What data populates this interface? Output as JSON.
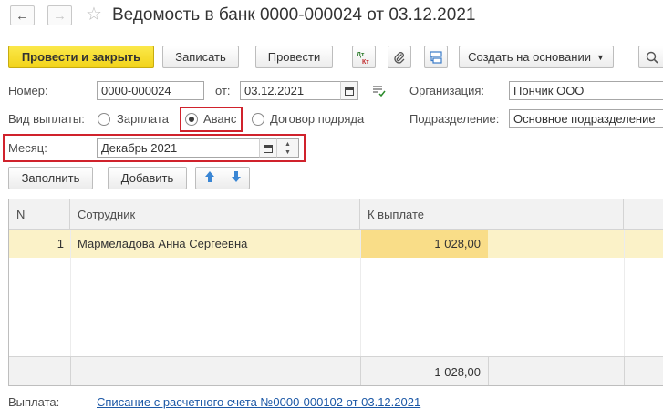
{
  "header": {
    "back_icon": "arrow-left-icon",
    "forward_icon": "arrow-right-icon",
    "favorite_icon": "star-icon",
    "title": "Ведомость в банк 0000-000024 от 03.12.2021"
  },
  "toolbar": {
    "post_close_label": "Провести и закрыть",
    "save_label": "Записать",
    "post_label": "Провести",
    "dtkt_top": "Дт",
    "dtkt_bottom": "Кт",
    "create_based_label": "Создать на основании"
  },
  "form": {
    "number_label": "Номер:",
    "number_value": "0000-000024",
    "date_label": "от:",
    "date_value": "03.12.2021",
    "org_label": "Организация:",
    "org_value": "Пончик ООО",
    "payment_type_label": "Вид выплаты:",
    "payment_options": [
      "Зарплата",
      "Аванс",
      "Договор подряда"
    ],
    "selected_payment": "Аванс",
    "division_label": "Подразделение:",
    "division_value": "Основное подразделение",
    "month_label": "Месяц:",
    "month_value": "Декабрь 2021"
  },
  "table_toolbar": {
    "fill_label": "Заполнить",
    "add_label": "Добавить"
  },
  "table": {
    "columns": [
      "N",
      "Сотрудник",
      "К выплате"
    ],
    "rows": [
      {
        "n": "1",
        "employee": "Мармеладова Анна Сергеевна",
        "amount": "1 028,00"
      }
    ],
    "total": "1 028,00"
  },
  "payment": {
    "label": "Выплата:",
    "link": "Списание с расчетного счета №0000-000102 от 03.12.2021"
  },
  "colors": {
    "primary_button": "#f2d31a",
    "highlight_red": "#d0222c",
    "selected_row": "#fbf2c8",
    "link": "#1c58a6"
  }
}
